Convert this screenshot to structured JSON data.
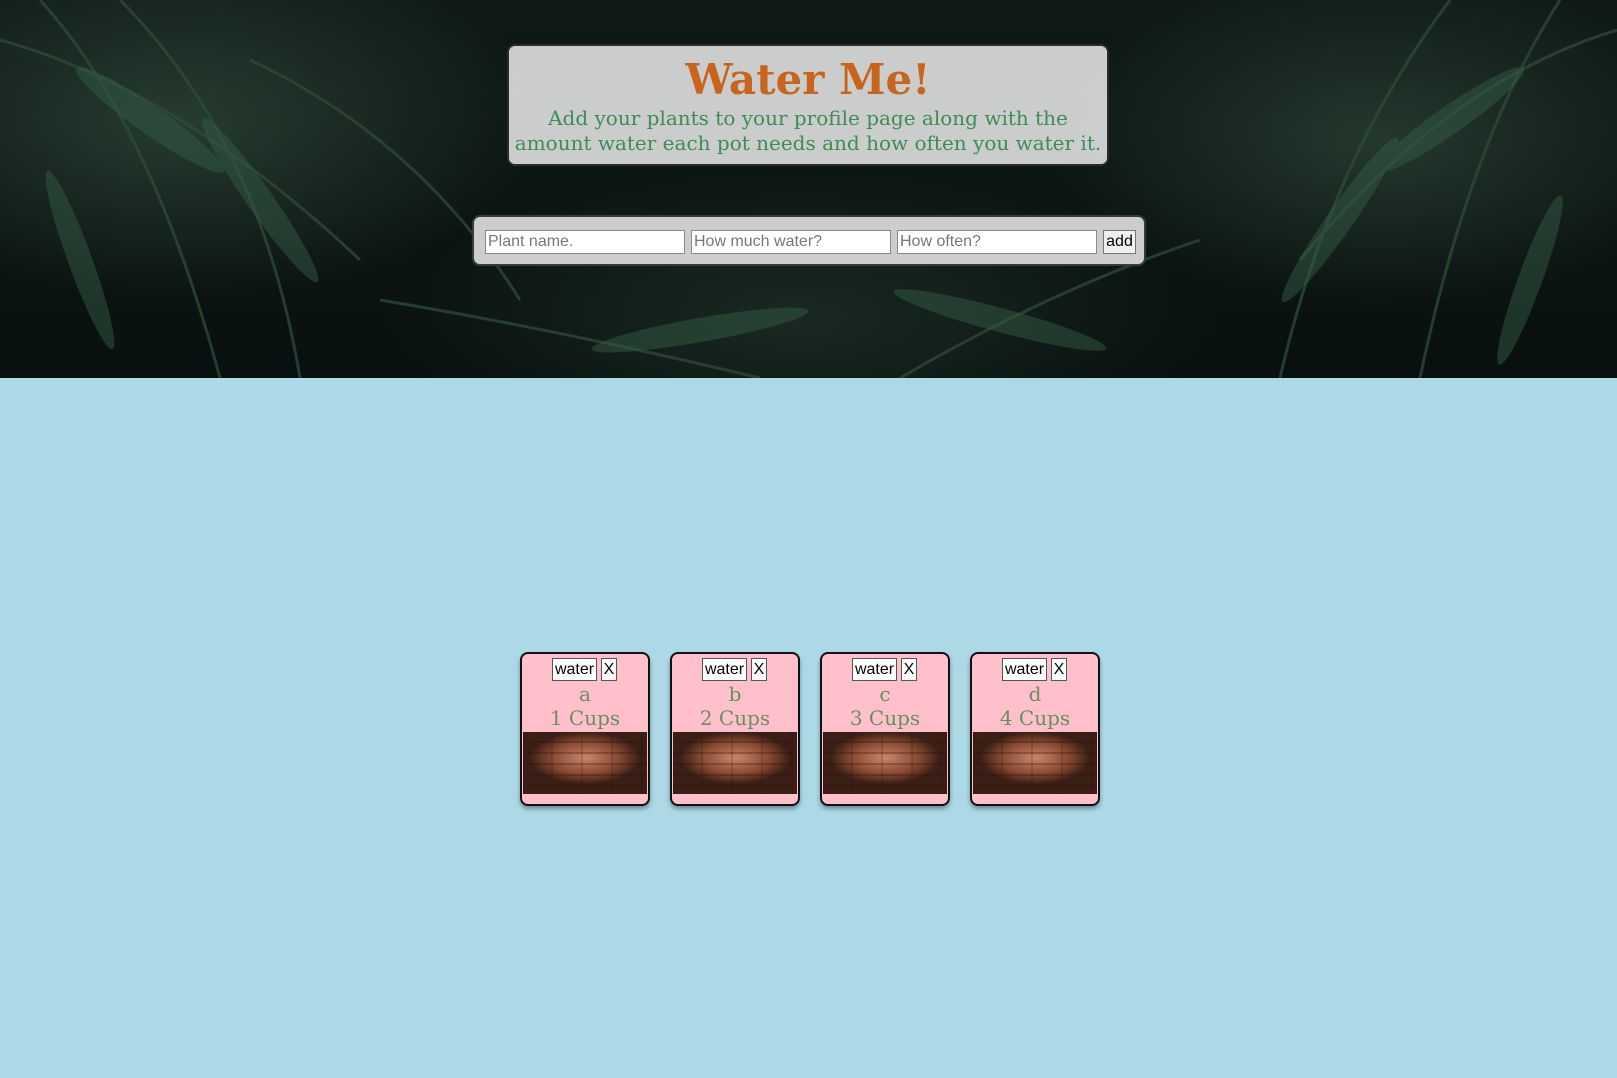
{
  "header": {
    "title": "Water Me!",
    "subtitle": "Add your plants to your profile page along with the amount water each pot needs and how often you water it."
  },
  "form": {
    "name_placeholder": "Plant name.",
    "amount_placeholder": "How much water?",
    "often_placeholder": "How often?",
    "add_label": "add"
  },
  "plants": [
    {
      "water_label": "water",
      "remove_label": "X",
      "name": "a",
      "amount": "1 Cups"
    },
    {
      "water_label": "water",
      "remove_label": "X",
      "name": "b",
      "amount": "2 Cups"
    },
    {
      "water_label": "water",
      "remove_label": "X",
      "name": "c",
      "amount": "3 Cups"
    },
    {
      "water_label": "water",
      "remove_label": "X",
      "name": "d",
      "amount": "4 Cups"
    }
  ],
  "colors": {
    "page_background": "#add8e6",
    "title": "#c8641e",
    "subtitle": "#3e8c57",
    "card_background": "#ffc0cb",
    "card_text": "#6a8f5e"
  }
}
